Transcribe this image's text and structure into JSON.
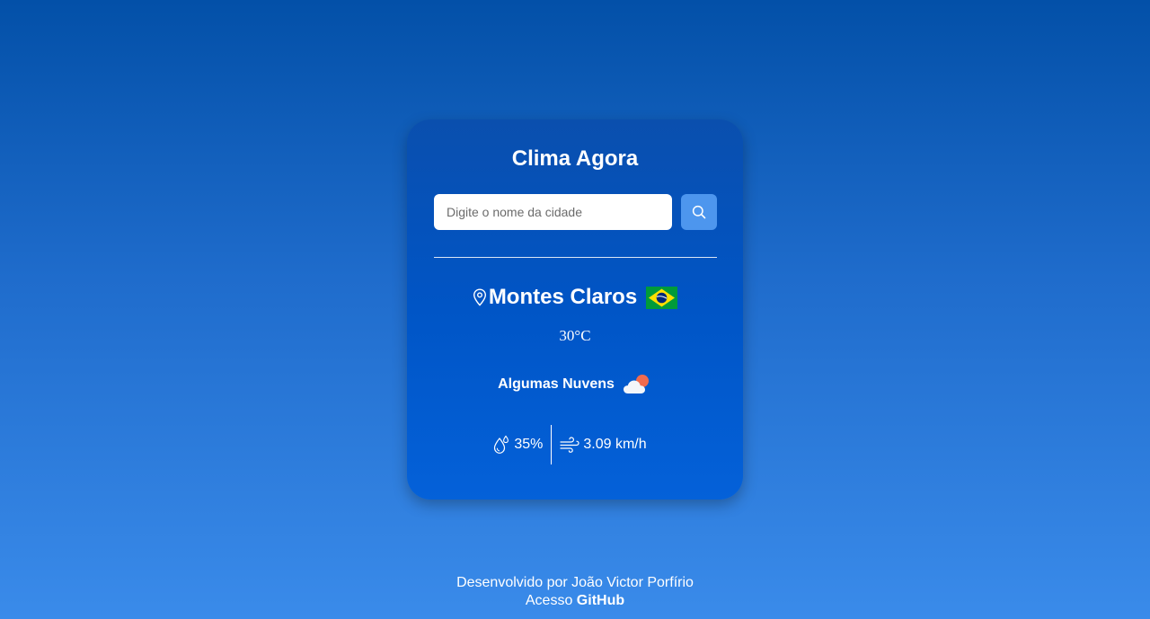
{
  "app": {
    "title": "Clima Agora"
  },
  "search": {
    "placeholder": "Digite o nome da cidade",
    "value": "",
    "button_icon": "search-icon"
  },
  "weather": {
    "city": "Montes Claros",
    "country_flag": "brazil-flag",
    "temperature": "30°C",
    "description": "Algumas Nuvens",
    "description_icon": "partly-cloudy-icon",
    "humidity": "35%",
    "humidity_icon": "humidity-icon",
    "wind": "3.09 km/h",
    "wind_icon": "wind-icon"
  },
  "footer": {
    "credit": "Desenvolvido por João Victor Porfírio",
    "access_prefix": "Acesso",
    "access_link": "GitHub"
  },
  "colors": {
    "background_top": "#0350a8",
    "background_bottom": "#3a8bea",
    "card": "#0055c6",
    "search_button": "#4d96ee"
  }
}
